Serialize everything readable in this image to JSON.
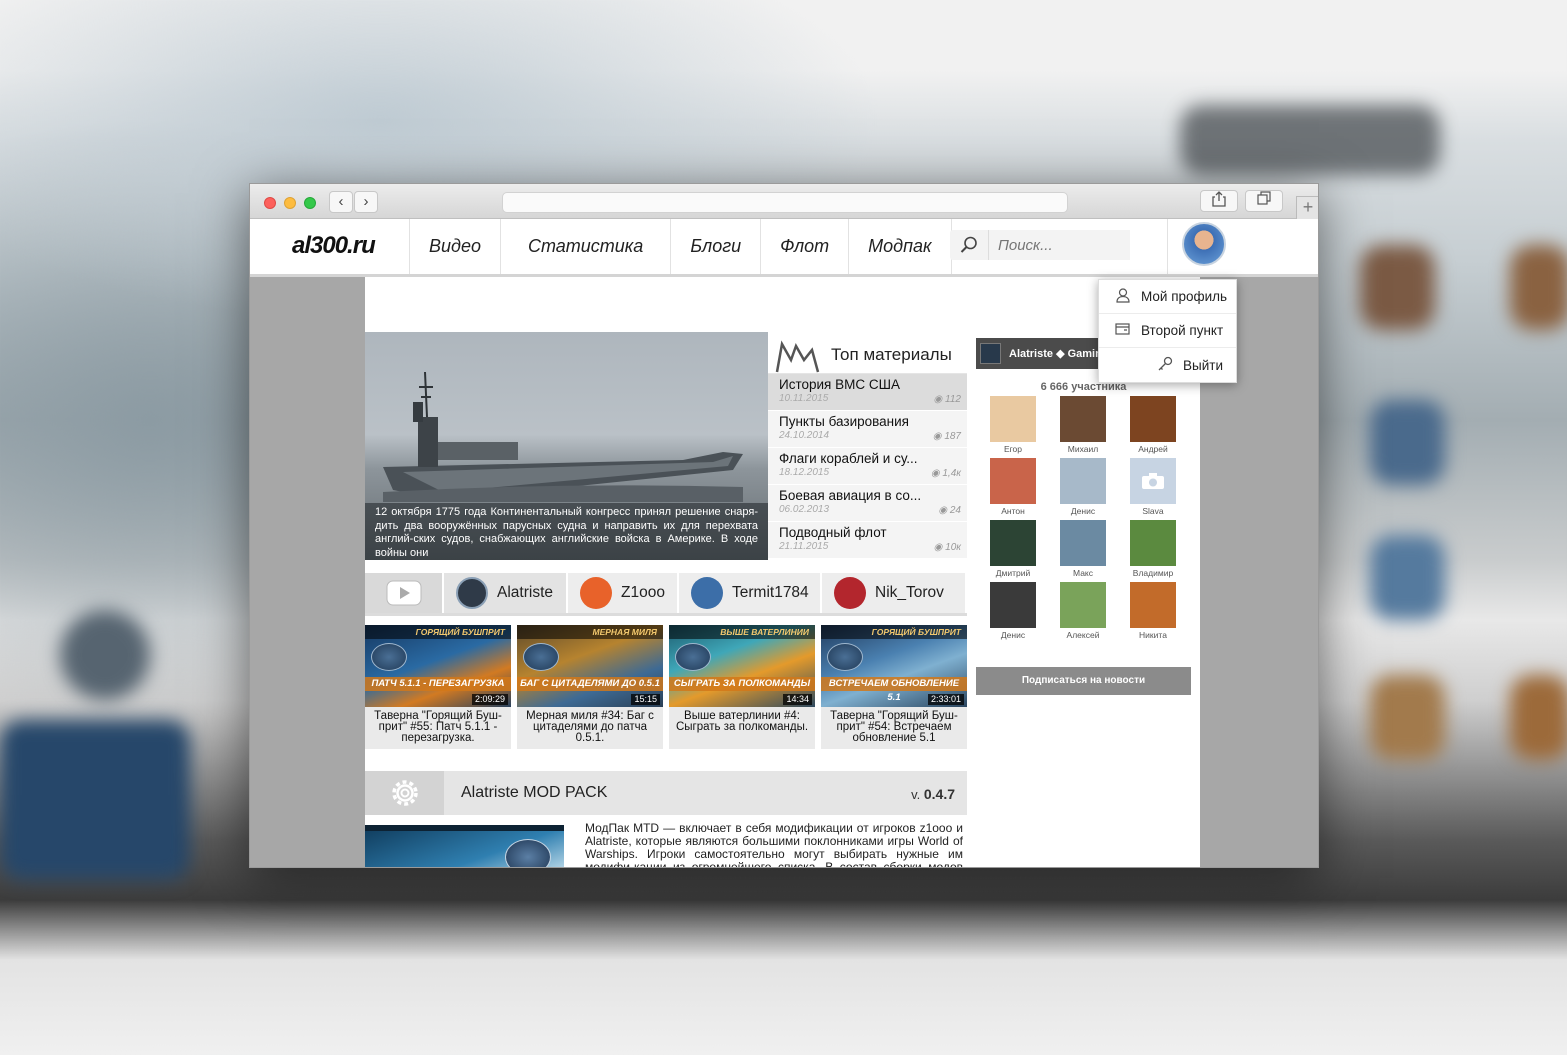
{
  "browser": {
    "back_icon": "chevron-left-icon",
    "forward_icon": "chevron-right-icon",
    "share_icon": "share-icon",
    "tabs_icon": "tabs-icon",
    "new_tab_label": "+"
  },
  "site": {
    "logo": "al300.ru",
    "menu": [
      {
        "label": "Видео"
      },
      {
        "label": "Статистика"
      },
      {
        "label": "Блоги"
      },
      {
        "label": "Флот"
      },
      {
        "label": "Модпак"
      }
    ],
    "search": {
      "placeholder": "Поиск..."
    }
  },
  "user_menu": {
    "items": [
      {
        "label": "Мой профиль",
        "icon": "user-icon"
      },
      {
        "label": "Второй пункт",
        "icon": "card-icon"
      },
      {
        "label": "Выйти",
        "icon": "key-icon"
      }
    ]
  },
  "hero": {
    "caption": "12 октября 1775 года Континентальный конгресс принял решение снаря-дить два вооружённых парусных судна и направить их для перехвата англий-ских судов, снабжающих английские войска в Америке. В ходе войны они"
  },
  "top_materials": {
    "title": "Топ материалы",
    "items": [
      {
        "title": "История ВМС США",
        "date": "10.11.2015",
        "views": "112"
      },
      {
        "title": "Пункты базирования",
        "date": "24.10.2014",
        "views": "187"
      },
      {
        "title": "Флаги кораблей и су...",
        "date": "18.12.2015",
        "views": "1,4к"
      },
      {
        "title": "Боевая авиация в со...",
        "date": "06.02.2013",
        "views": "24"
      },
      {
        "title": "Подводный флот",
        "date": "21.11.2015",
        "views": "10к"
      }
    ]
  },
  "channels": [
    {
      "name": "Alatriste",
      "color": "#2f3a48"
    },
    {
      "name": "Z1ooo",
      "color": "#e8622a"
    },
    {
      "name": "Termit1784",
      "color": "#3c6ea8"
    },
    {
      "name": "Nik_Torov",
      "color": "#b3262d"
    }
  ],
  "videos": [
    {
      "banner": "ГОРЯЩИЙ БУШПРИТ",
      "headline": "ПАТЧ 5.1.1 - ПЕРЕЗАГРУЗКА",
      "duration": "2:09:29",
      "title": "Таверна \"Горящий Буш-прит\" #55: Патч 5.1.1 - перезагрузка."
    },
    {
      "banner": "МЕРНАЯ МИЛЯ",
      "headline": "БАГ С ЦИТАДЕЛЯМИ ДО 0.5.1",
      "duration": "15:15",
      "title": "Мерная миля #34: Баг с цитаделями до патча 0.5.1."
    },
    {
      "banner": "ВЫШЕ ВАТЕРЛИНИИ",
      "headline": "СЫГРАТЬ ЗА ПОЛКОМАНДЫ",
      "duration": "14:34",
      "title": "Выше ватерлинии #4: Сыграть за полкоманды."
    },
    {
      "banner": "ГОРЯЩИЙ БУШПРИТ",
      "headline": "ВСТРЕЧАЕМ ОБНОВЛЕНИЕ 5.1",
      "duration": "2:33:01",
      "title": "Таверна \"Горящий Буш-прит\" #54: Встречаем обновление 5.1"
    }
  ],
  "modpack": {
    "title": "Alatriste MOD PACK",
    "version_prefix": "v.",
    "version": "0.4.7",
    "description": "МодПак MTD — включает в себя модификации от игроков z1ooo и Alatriste, которые являются большими поклонниками игры World of Warships. Игроки самостоятельно могут выбирать нужные им модифи-кации из огромнейшего списка. В состав сборки модов вошло мно-"
  },
  "community": {
    "name": "Alatriste ◆ Gaming",
    "members": "6 666 участника",
    "people": [
      {
        "name": "Егор",
        "color": "#e9c9a1"
      },
      {
        "name": "Михаил",
        "color": "#6b4a33"
      },
      {
        "name": "Андрей",
        "color": "#7d4420"
      },
      {
        "name": "Антон",
        "color": "#c9644a"
      },
      {
        "name": "Денис",
        "color": "#a7b9c9"
      },
      {
        "name": "Slava",
        "color": "#c7d4e3"
      },
      {
        "name": "Дмитрий",
        "color": "#2c4434"
      },
      {
        "name": "Макс",
        "color": "#6b8aa2"
      },
      {
        "name": "Владимир",
        "color": "#5b8a3f"
      },
      {
        "name": "Денис",
        "color": "#3a3a3a"
      },
      {
        "name": "Алексей",
        "color": "#7aa35a"
      },
      {
        "name": "Никита",
        "color": "#c26b2a"
      }
    ],
    "subscribe_label": "Подписаться на новости"
  }
}
